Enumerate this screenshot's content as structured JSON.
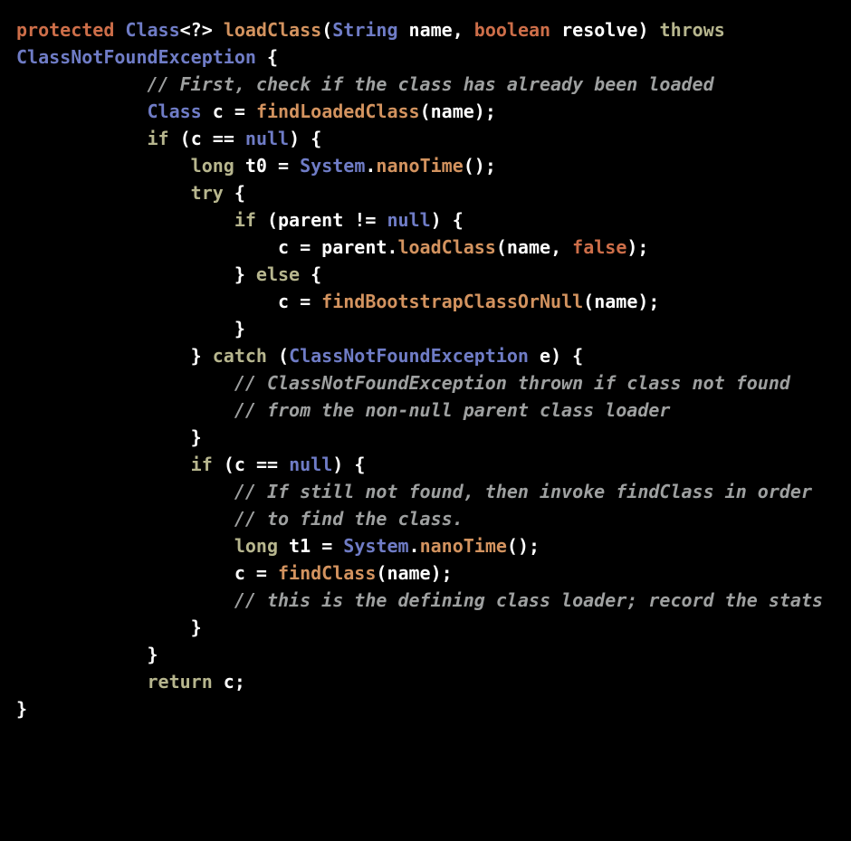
{
  "code": {
    "tokens": {
      "protected": "protected",
      "Class": "Class",
      "angleOpen": "<?>",
      "loadClass": "loadClass",
      "String": "String",
      "name": "name",
      "boolean": "boolean",
      "resolve": "resolve",
      "throws": "throws",
      "ClassNotFoundException": "ClassNotFoundException",
      "lbrace": "{",
      "rbrace": "}",
      "comment1": "// First, check if the class has already been loaded",
      "line_findLoaded_pre": "Class",
      "c": "c",
      "eq": "=",
      "findLoadedClass": "findLoadedClass",
      "lparen": "(",
      "rparen": ")",
      "semi": ";",
      "if": "if",
      "eqeq": "==",
      "null": "null",
      "long": "long",
      "t0": "t0",
      "System": "System",
      "dot": ".",
      "nanoTime": "nanoTime",
      "try": "try",
      "parent": "parent",
      "neq": "!=",
      "comma": ",",
      "false": "false",
      "else": "else",
      "findBootstrapClassOrNull": "findBootstrapClassOrNull",
      "catch": "catch",
      "e": "e",
      "comment2": "// ClassNotFoundException thrown if class not found",
      "comment3": "// from the non-null parent class loader",
      "comment4": "// If still not found, then invoke findClass in order",
      "comment5": "// to find the class.",
      "t1": "t1",
      "findClass": "findClass",
      "comment6": "// this is the defining class loader; record the stats",
      "return": "return"
    }
  }
}
